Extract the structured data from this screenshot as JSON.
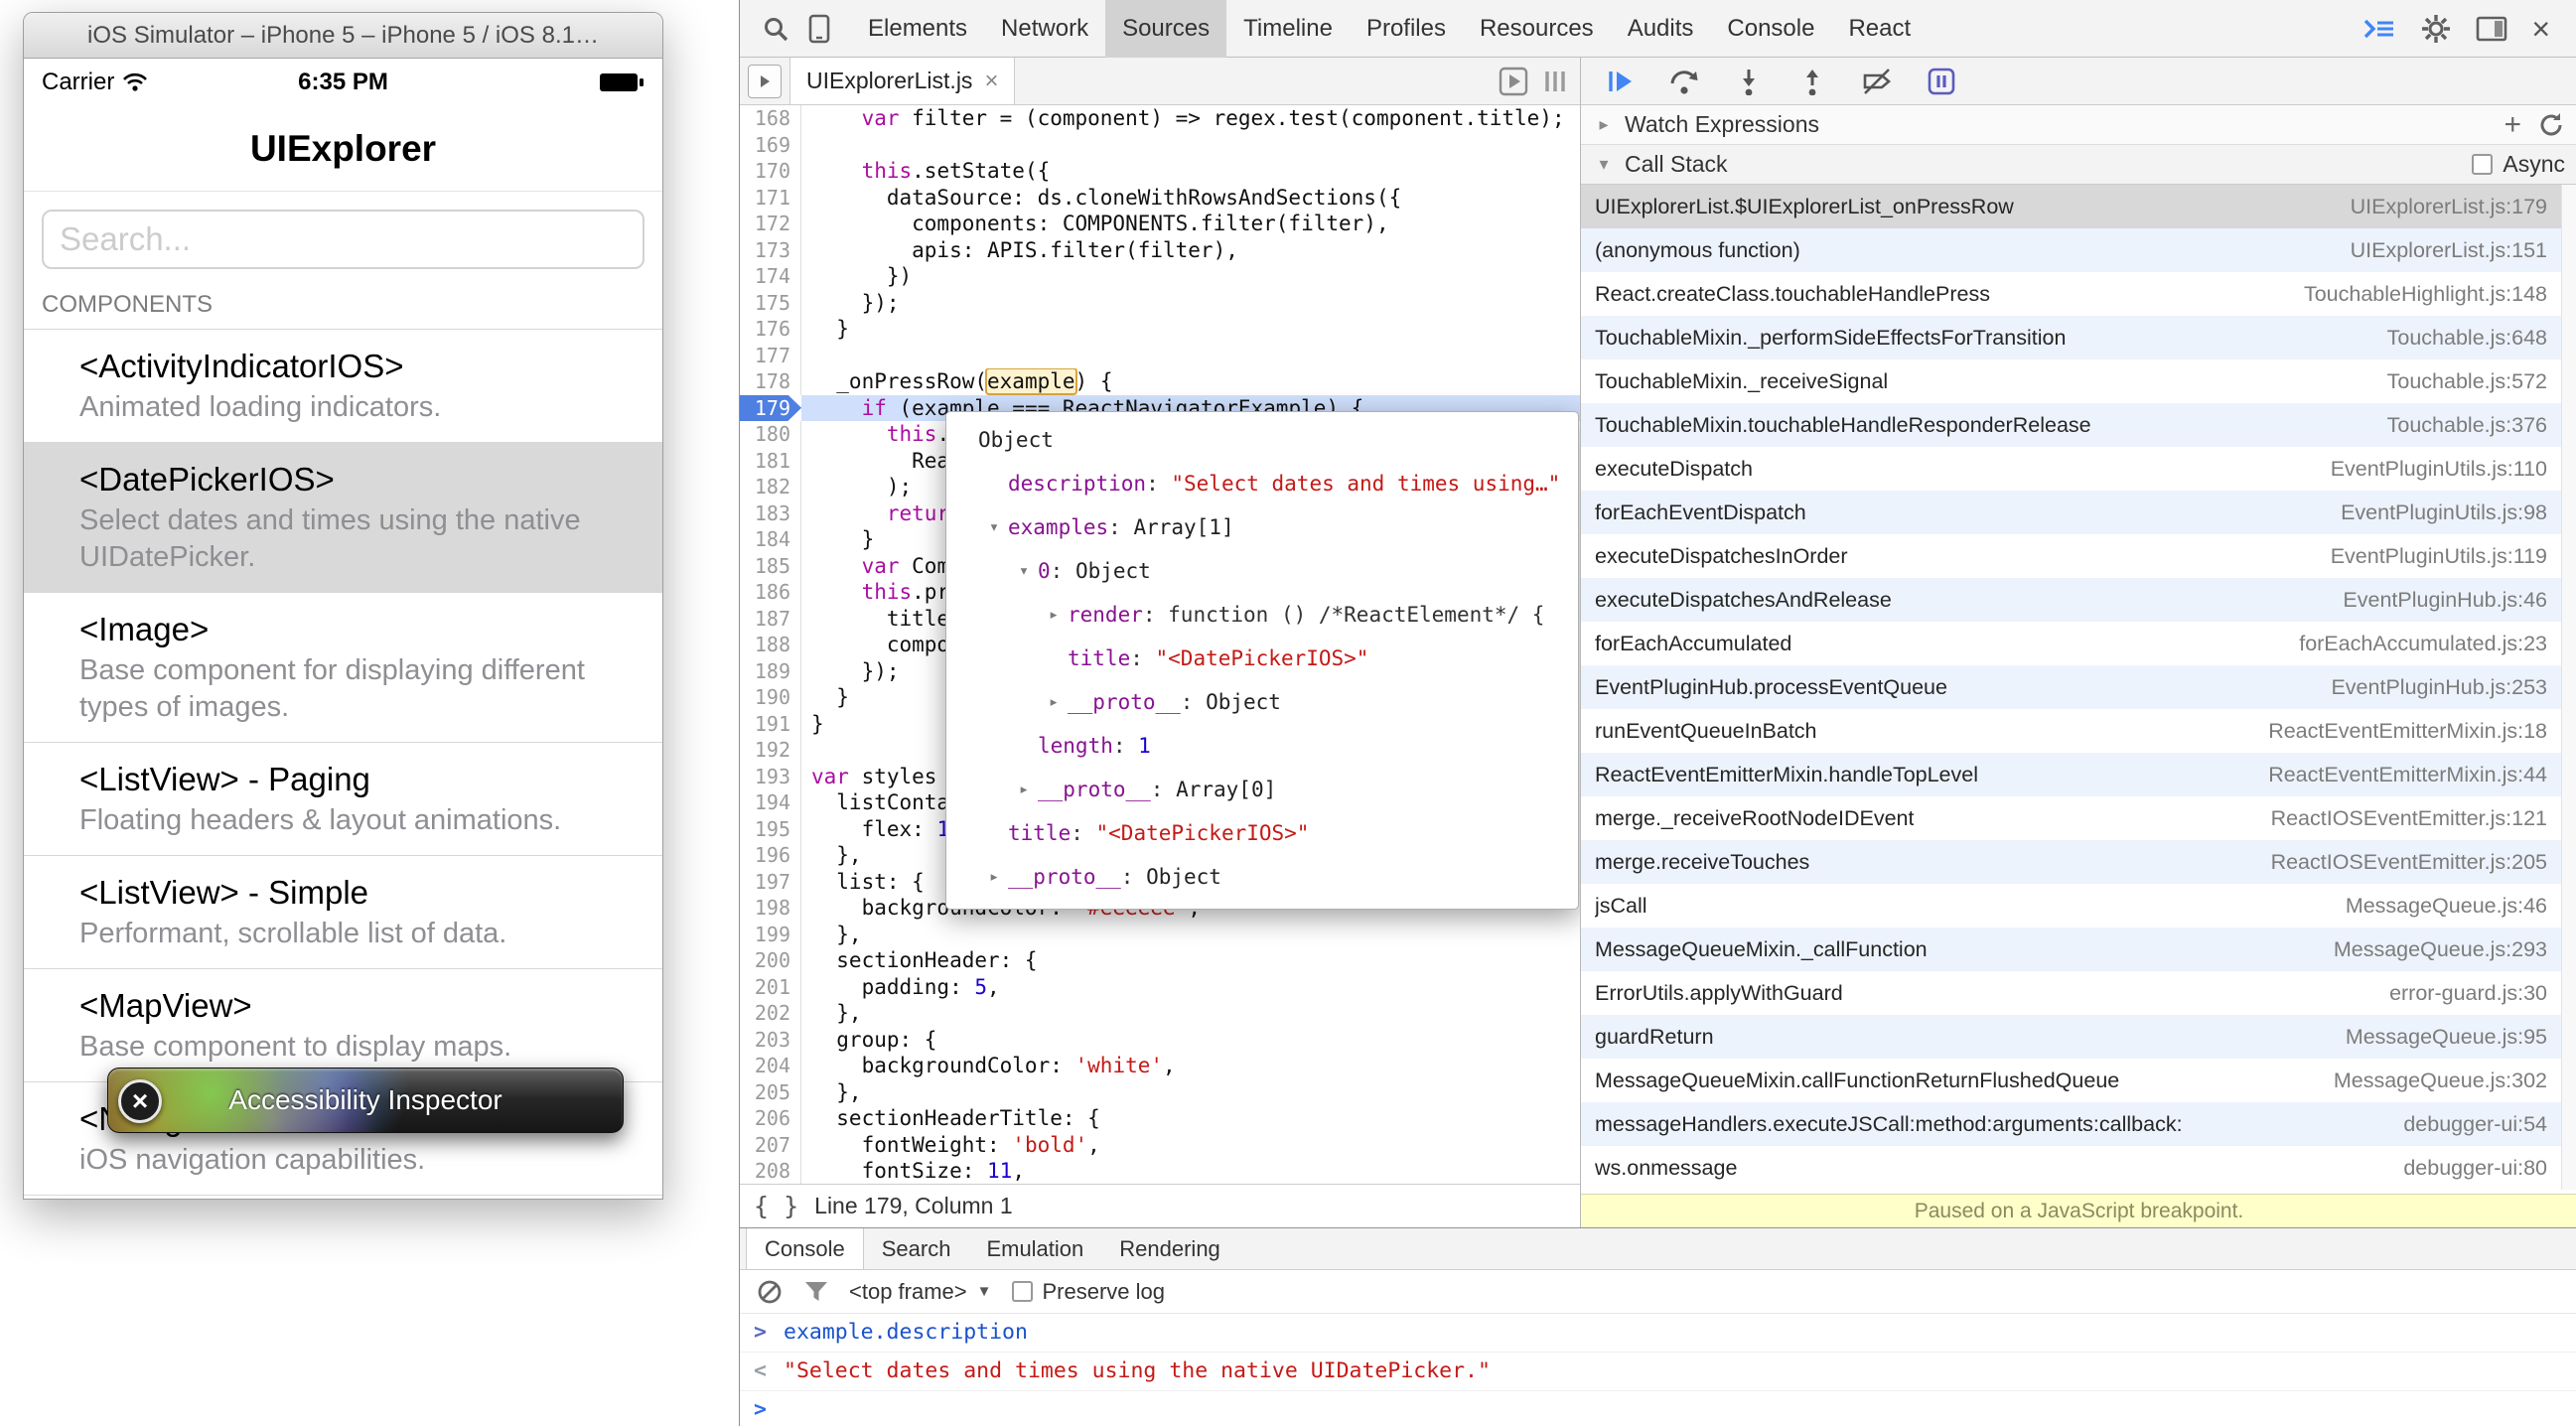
{
  "simulator": {
    "window_title": "iOS Simulator – iPhone 5 – iPhone 5 / iOS 8.1…",
    "status_bar": {
      "carrier": "Carrier",
      "time": "6:35 PM"
    },
    "nav_title": "UIExplorer",
    "search_placeholder": "Search...",
    "section_header": "COMPONENTS",
    "tooltip_label": "Accessibility Inspector",
    "components": [
      {
        "title": "<ActivityIndicatorIOS>",
        "subtitle": "Animated loading indicators.",
        "selected": false
      },
      {
        "title": "<DatePickerIOS>",
        "subtitle": "Select dates and times using the native UIDatePicker.",
        "selected": true
      },
      {
        "title": "<Image>",
        "subtitle": "Base component for displaying different types of images.",
        "selected": false
      },
      {
        "title": "<ListView> - Paging",
        "subtitle": "Floating headers & layout animations.",
        "selected": false
      },
      {
        "title": "<ListView> - Simple",
        "subtitle": "Performant, scrollable list of data.",
        "selected": false
      },
      {
        "title": "<MapView>",
        "subtitle": "Base component to display maps.",
        "selected": false
      },
      {
        "title": "<NavigatorIOS>",
        "subtitle": "iOS navigation capabilities.",
        "selected": false
      }
    ]
  },
  "devtools": {
    "toolbar": {
      "tabs": [
        "Elements",
        "Network",
        "Sources",
        "Timeline",
        "Profiles",
        "Resources",
        "Audits",
        "Console",
        "React"
      ],
      "selected_tab": "Sources"
    },
    "editor": {
      "file_tab": "UIExplorerList.js",
      "status": "Line 179, Column 1",
      "active_line": 179,
      "lines": [
        {
          "n": 168,
          "t": [
            [
              "p",
              "    "
            ],
            [
              "k",
              "var"
            ],
            [
              "p",
              " filter = (component) => regex.test(component.title);"
            ]
          ]
        },
        {
          "n": 169,
          "t": []
        },
        {
          "n": 170,
          "t": [
            [
              "p",
              "    "
            ],
            [
              "k",
              "this"
            ],
            [
              "p",
              ".setState({"
            ]
          ]
        },
        {
          "n": 171,
          "t": [
            [
              "p",
              "      dataSource: ds.cloneWithRowsAndSections({"
            ]
          ]
        },
        {
          "n": 172,
          "t": [
            [
              "p",
              "        components: COMPONENTS.filter(filter),"
            ]
          ]
        },
        {
          "n": 173,
          "t": [
            [
              "p",
              "        apis: APIS.filter(filter),"
            ]
          ]
        },
        {
          "n": 174,
          "t": [
            [
              "p",
              "      })"
            ]
          ]
        },
        {
          "n": 175,
          "t": [
            [
              "p",
              "    });"
            ]
          ]
        },
        {
          "n": 176,
          "t": [
            [
              "p",
              "  }"
            ]
          ]
        },
        {
          "n": 177,
          "t": []
        },
        {
          "n": 178,
          "t": [
            [
              "p",
              "  _onPressRow("
            ],
            [
              "b",
              "example"
            ],
            [
              "p",
              ") {"
            ]
          ]
        },
        {
          "n": 179,
          "t": [
            [
              "p",
              "    "
            ],
            [
              "k",
              "if"
            ],
            [
              "p",
              " (example === ReactNavigatorExample) {"
            ]
          ]
        },
        {
          "n": 180,
          "t": [
            [
              "p",
              "      "
            ],
            [
              "k",
              "this"
            ],
            [
              "p",
              ".props.navigator.push("
            ]
          ]
        },
        {
          "n": 181,
          "t": [
            [
              "p",
              "        ReactNavigatorExample"
            ]
          ]
        },
        {
          "n": 182,
          "t": [
            [
              "p",
              "      );"
            ]
          ]
        },
        {
          "n": 183,
          "t": [
            [
              "p",
              "      "
            ],
            [
              "k",
              "return"
            ],
            [
              "p",
              ";"
            ]
          ]
        },
        {
          "n": 184,
          "t": [
            [
              "p",
              "    }"
            ]
          ]
        },
        {
          "n": 185,
          "t": [
            [
              "p",
              "    "
            ],
            [
              "k",
              "var"
            ],
            [
              "p",
              " Component = example.component;"
            ]
          ]
        },
        {
          "n": 186,
          "t": [
            [
              "p",
              "    "
            ],
            [
              "k",
              "this"
            ],
            [
              "p",
              ".props.navigator.push({"
            ]
          ]
        },
        {
          "n": 187,
          "t": [
            [
              "p",
              "      title: example.title,"
            ]
          ]
        },
        {
          "n": 188,
          "t": [
            [
              "p",
              "      component: Component,"
            ]
          ]
        },
        {
          "n": 189,
          "t": [
            [
              "p",
              "    });"
            ]
          ]
        },
        {
          "n": 190,
          "t": [
            [
              "p",
              "  }"
            ]
          ]
        },
        {
          "n": 191,
          "t": [
            [
              "p",
              "}"
            ]
          ]
        },
        {
          "n": 192,
          "t": []
        },
        {
          "n": 193,
          "t": [
            [
              "k",
              "var"
            ],
            [
              "p",
              " styles = StyleSheet.create({"
            ]
          ]
        },
        {
          "n": 194,
          "t": [
            [
              "p",
              "  listContainer: {"
            ]
          ]
        },
        {
          "n": 195,
          "t": [
            [
              "p",
              "    flex: "
            ],
            [
              "n2",
              "1"
            ],
            [
              "p",
              ","
            ]
          ]
        },
        {
          "n": 196,
          "t": [
            [
              "p",
              "  },"
            ]
          ]
        },
        {
          "n": 197,
          "t": [
            [
              "p",
              "  list: {"
            ]
          ]
        },
        {
          "n": 198,
          "t": [
            [
              "p",
              "    backgroundColor: "
            ],
            [
              "s",
              "'#eeeeee'"
            ],
            [
              "p",
              ","
            ]
          ]
        },
        {
          "n": 199,
          "t": [
            [
              "p",
              "  },"
            ]
          ]
        },
        {
          "n": 200,
          "t": [
            [
              "p",
              "  sectionHeader: {"
            ]
          ]
        },
        {
          "n": 201,
          "t": [
            [
              "p",
              "    padding: "
            ],
            [
              "n2",
              "5"
            ],
            [
              "p",
              ","
            ]
          ]
        },
        {
          "n": 202,
          "t": [
            [
              "p",
              "  },"
            ]
          ]
        },
        {
          "n": 203,
          "t": [
            [
              "p",
              "  group: {"
            ]
          ]
        },
        {
          "n": 204,
          "t": [
            [
              "p",
              "    backgroundColor: "
            ],
            [
              "s",
              "'white'"
            ],
            [
              "p",
              ","
            ]
          ]
        },
        {
          "n": 205,
          "t": [
            [
              "p",
              "  },"
            ]
          ]
        },
        {
          "n": 206,
          "t": [
            [
              "p",
              "  sectionHeaderTitle: {"
            ]
          ]
        },
        {
          "n": 207,
          "t": [
            [
              "p",
              "    fontWeight: "
            ],
            [
              "s",
              "'bold'"
            ],
            [
              "p",
              ","
            ]
          ]
        },
        {
          "n": 208,
          "t": [
            [
              "p",
              "    fontSize: "
            ],
            [
              "n2",
              "11"
            ],
            [
              "p",
              ","
            ]
          ]
        }
      ]
    },
    "popup": {
      "rows": [
        {
          "i": 0,
          "a": "",
          "t": [
            [
              "obj",
              "Object"
            ]
          ]
        },
        {
          "i": 1,
          "a": "",
          "t": [
            [
              "prop",
              "description"
            ],
            [
              "p",
              ": "
            ],
            [
              "s",
              "\"Select dates and times using…\""
            ]
          ]
        },
        {
          "i": 1,
          "a": "d",
          "t": [
            [
              "prop",
              "examples"
            ],
            [
              "p",
              ": "
            ],
            [
              "obj",
              "Array[1]"
            ]
          ]
        },
        {
          "i": 2,
          "a": "d",
          "t": [
            [
              "prop",
              "0"
            ],
            [
              "p",
              ": "
            ],
            [
              "obj",
              "Object"
            ]
          ]
        },
        {
          "i": 3,
          "a": "r",
          "t": [
            [
              "prop",
              "render"
            ],
            [
              "p",
              ": "
            ],
            [
              "p",
              "function () /*ReactElement*/ {"
            ]
          ]
        },
        {
          "i": 3,
          "a": "",
          "t": [
            [
              "prop",
              "title"
            ],
            [
              "p",
              ": "
            ],
            [
              "s",
              "\"<DatePickerIOS>\""
            ]
          ]
        },
        {
          "i": 3,
          "a": "r",
          "t": [
            [
              "prop",
              "__proto__"
            ],
            [
              "p",
              ": "
            ],
            [
              "obj",
              "Object"
            ]
          ]
        },
        {
          "i": 2,
          "a": "",
          "t": [
            [
              "prop",
              "length"
            ],
            [
              "p",
              ": "
            ],
            [
              "n",
              "1"
            ]
          ]
        },
        {
          "i": 2,
          "a": "r",
          "t": [
            [
              "prop",
              "__proto__"
            ],
            [
              "p",
              ": "
            ],
            [
              "obj",
              "Array[0]"
            ]
          ]
        },
        {
          "i": 1,
          "a": "",
          "t": [
            [
              "prop",
              "title"
            ],
            [
              "p",
              ": "
            ],
            [
              "s",
              "\"<DatePickerIOS>\""
            ]
          ]
        },
        {
          "i": 1,
          "a": "r",
          "t": [
            [
              "prop",
              "__proto__"
            ],
            [
              "p",
              ": "
            ],
            [
              "obj",
              "Object"
            ]
          ]
        }
      ]
    },
    "debugger": {
      "watch_label": "Watch Expressions",
      "call_stack_label": "Call Stack",
      "async_label": "Async",
      "paused_message": "Paused on a JavaScript breakpoint.",
      "frames": [
        {
          "fn": "UIExplorerList.$UIExplorerList_onPressRow",
          "loc": "UIExplorerList.js:179",
          "selected": true
        },
        {
          "fn": "(anonymous function)",
          "loc": "UIExplorerList.js:151",
          "selected": false
        },
        {
          "fn": "React.createClass.touchableHandlePress",
          "loc": "TouchableHighlight.js:148",
          "selected": false
        },
        {
          "fn": "TouchableMixin._performSideEffectsForTransition",
          "loc": "Touchable.js:648",
          "selected": false
        },
        {
          "fn": "TouchableMixin._receiveSignal",
          "loc": "Touchable.js:572",
          "selected": false
        },
        {
          "fn": "TouchableMixin.touchableHandleResponderRelease",
          "loc": "Touchable.js:376",
          "selected": false
        },
        {
          "fn": "executeDispatch",
          "loc": "EventPluginUtils.js:110",
          "selected": false
        },
        {
          "fn": "forEachEventDispatch",
          "loc": "EventPluginUtils.js:98",
          "selected": false
        },
        {
          "fn": "executeDispatchesInOrder",
          "loc": "EventPluginUtils.js:119",
          "selected": false
        },
        {
          "fn": "executeDispatchesAndRelease",
          "loc": "EventPluginHub.js:46",
          "selected": false
        },
        {
          "fn": "forEachAccumulated",
          "loc": "forEachAccumulated.js:23",
          "selected": false
        },
        {
          "fn": "EventPluginHub.processEventQueue",
          "loc": "EventPluginHub.js:253",
          "selected": false
        },
        {
          "fn": "runEventQueueInBatch",
          "loc": "ReactEventEmitterMixin.js:18",
          "selected": false
        },
        {
          "fn": "ReactEventEmitterMixin.handleTopLevel",
          "loc": "ReactEventEmitterMixin.js:44",
          "selected": false
        },
        {
          "fn": "merge._receiveRootNodeIDEvent",
          "loc": "ReactIOSEventEmitter.js:121",
          "selected": false
        },
        {
          "fn": "merge.receiveTouches",
          "loc": "ReactIOSEventEmitter.js:205",
          "selected": false
        },
        {
          "fn": "jsCall",
          "loc": "MessageQueue.js:46",
          "selected": false
        },
        {
          "fn": "MessageQueueMixin._callFunction",
          "loc": "MessageQueue.js:293",
          "selected": false
        },
        {
          "fn": "ErrorUtils.applyWithGuard",
          "loc": "error-guard.js:30",
          "selected": false
        },
        {
          "fn": "guardReturn",
          "loc": "MessageQueue.js:95",
          "selected": false
        },
        {
          "fn": "MessageQueueMixin.callFunctionReturnFlushedQueue",
          "loc": "MessageQueue.js:302",
          "selected": false
        },
        {
          "fn": "messageHandlers.executeJSCall:method:arguments:callback:",
          "loc": "debugger-ui:54",
          "selected": false
        },
        {
          "fn": "ws.onmessage",
          "loc": "debugger-ui:80",
          "selected": false
        }
      ]
    },
    "console": {
      "tabs": [
        "Console",
        "Search",
        "Emulation",
        "Rendering"
      ],
      "selected": "Console",
      "context": "<top frame>",
      "preserve_log_label": "Preserve log",
      "entries": [
        {
          "kind": "input",
          "text": "example.description"
        },
        {
          "kind": "output",
          "text": "\"Select dates and times using the native UIDatePicker.\""
        },
        {
          "kind": "prompt-line",
          "text": ""
        }
      ]
    }
  }
}
